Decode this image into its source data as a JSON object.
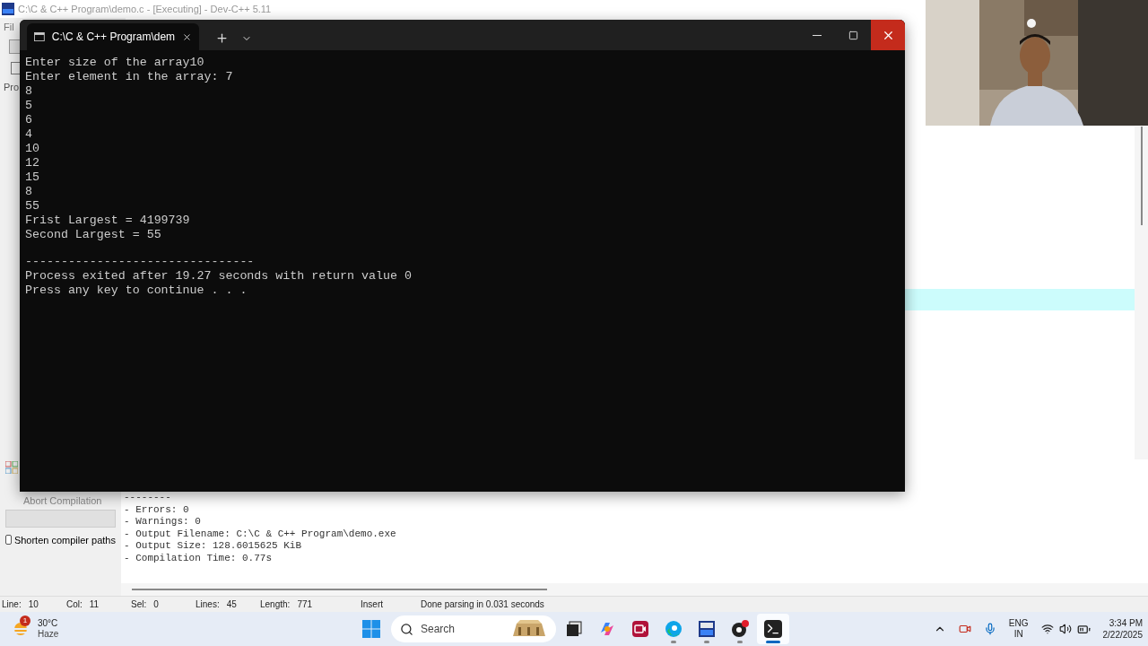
{
  "ide": {
    "title": "C:\\C & C++ Program\\demo.c - [Executing] - Dev-C++ 5.11",
    "menu": [
      "Fil"
    ],
    "side_tab": "Pro",
    "abort_button": {
      "label": "Abort Compilation",
      "disabled": true
    },
    "progress": {
      "level": 0
    },
    "shorten_paths": {
      "label": "Shorten compiler paths",
      "checked": false
    },
    "compile_log": [
      "--------",
      "- Errors: 0",
      "- Warnings: 0",
      "- Output Filename: C:\\C & C++ Program\\demo.exe",
      "- Output Size: 128.6015625 KiB",
      "- Compilation Time: 0.77s"
    ],
    "status_bar": [
      {
        "label": "Line:",
        "value": "10"
      },
      {
        "label": "Col:",
        "value": "11"
      },
      {
        "label": "Sel:",
        "value": "0"
      },
      {
        "label": "Lines:",
        "value": "45"
      },
      {
        "label": "Length:",
        "value": "771"
      }
    ],
    "mode": "Insert",
    "message": "Done parsing in 0.031 seconds"
  },
  "console": {
    "tab_title": "C:\\C & C++ Program\\dem",
    "output": [
      "Enter size of the array10",
      "Enter element in the array: 7",
      "8",
      "5",
      "6",
      "4",
      "10",
      "12",
      "15",
      "8",
      "55",
      "Frist Largest = 4199739",
      "Second Largest = 55"
    ],
    "separator": "--------------------------------",
    "summary": [
      "Process exited after 19.27 seconds with return value 0",
      "Press any key to continue . . ."
    ]
  },
  "taskbar": {
    "weather": {
      "badge": "1",
      "temperature": "30°C",
      "condition": "Haze"
    },
    "search": {
      "placeholder": "Search"
    },
    "apps": [
      {
        "kind": "taskview",
        "running": false,
        "active": false
      },
      {
        "kind": "copilot",
        "running": false,
        "active": false
      },
      {
        "kind": "recorder",
        "running": false,
        "active": false
      },
      {
        "kind": "edge",
        "running": true,
        "active": false
      },
      {
        "kind": "devcpp",
        "running": true,
        "active": false
      },
      {
        "kind": "obs",
        "running": true,
        "active": false
      },
      {
        "kind": "terminal",
        "running": true,
        "active": true
      }
    ],
    "language": "ENG",
    "region": "IN",
    "time": "3:34 PM",
    "date": "2/22/2025"
  }
}
